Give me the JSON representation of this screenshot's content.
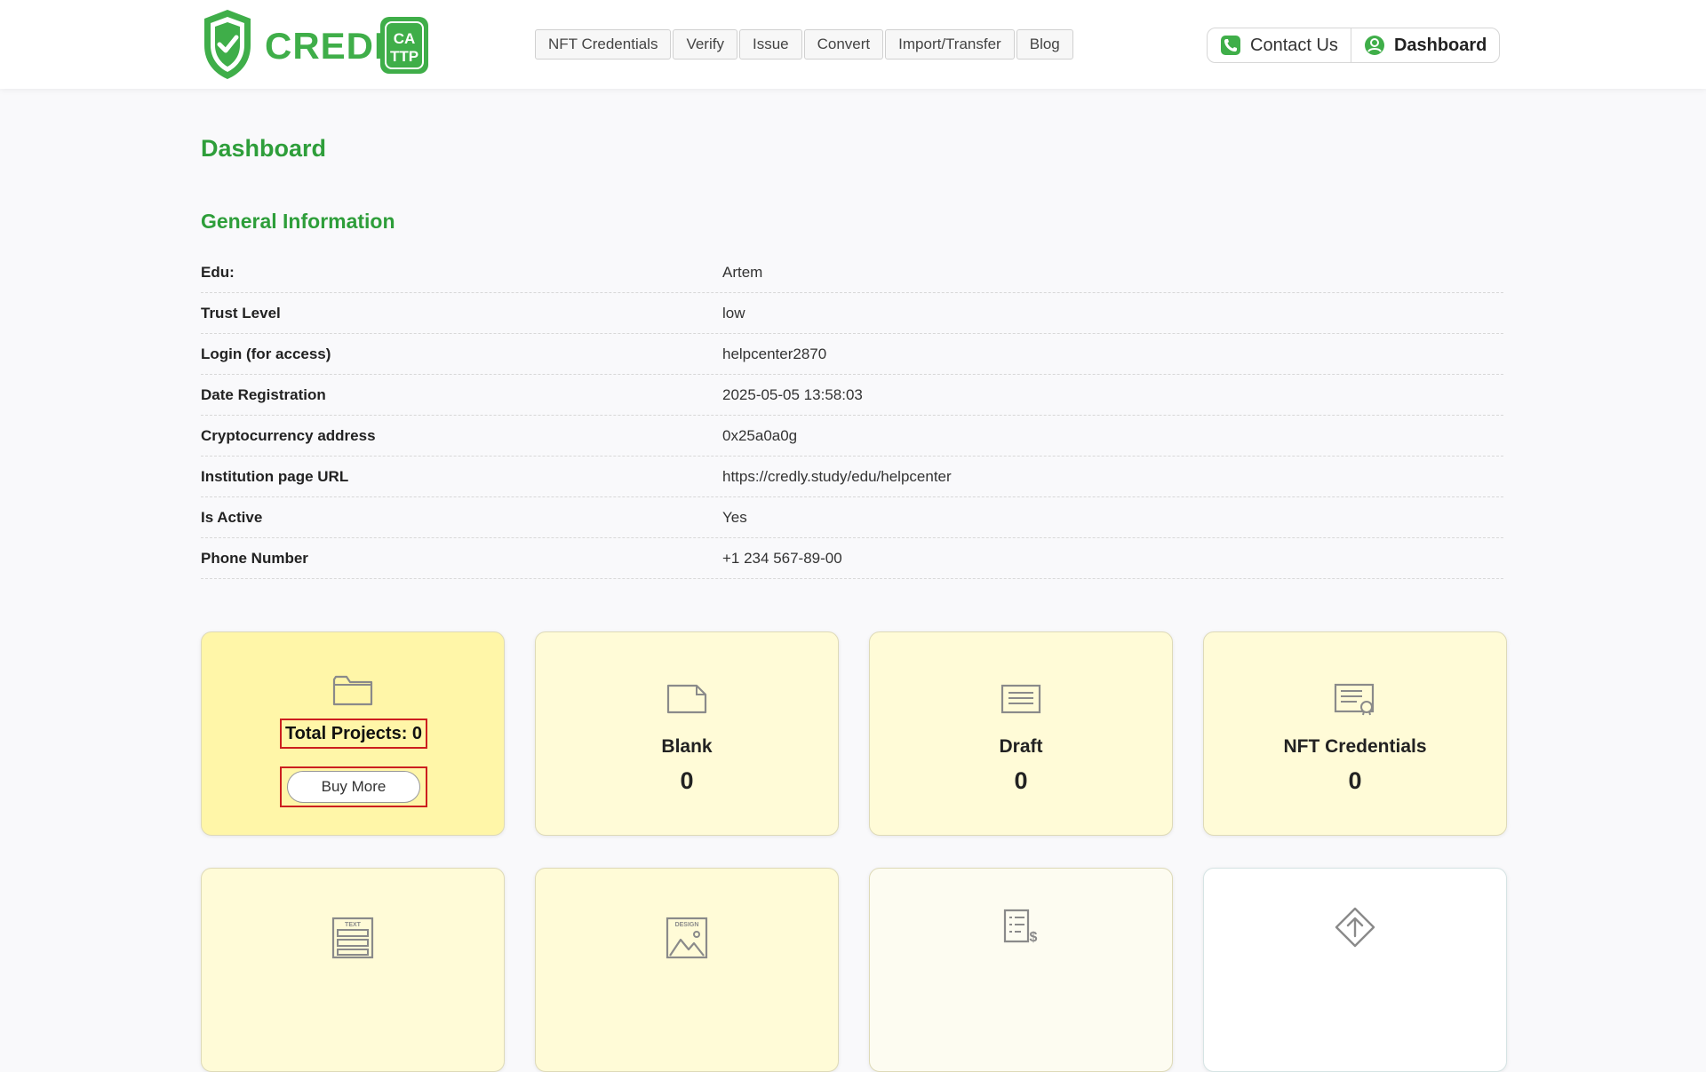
{
  "brand": {
    "name": "CREDLY",
    "badge_line1": "CA",
    "badge_line2": "TTP",
    "color": "#3fae49"
  },
  "nav": {
    "items": [
      {
        "label": "NFT Credentials"
      },
      {
        "label": "Verify"
      },
      {
        "label": "Issue"
      },
      {
        "label": "Convert"
      },
      {
        "label": "Import/Transfer"
      },
      {
        "label": "Blog"
      }
    ]
  },
  "header_actions": {
    "contact": {
      "label": "Contact Us",
      "icon": "phone-icon"
    },
    "dashboard": {
      "label": "Dashboard",
      "icon": "user-circle-icon"
    }
  },
  "page": {
    "title": "Dashboard",
    "section_title": "General Information"
  },
  "info": [
    {
      "label": "Edu:",
      "value": "Artem"
    },
    {
      "label": "Trust Level",
      "value": "low"
    },
    {
      "label": "Login (for access)",
      "value": "helpcenter2870"
    },
    {
      "label": "Date Registration",
      "value": "2025-05-05 13:58:03"
    },
    {
      "label": "Cryptocurrency address",
      "value": "0x25a0a0g"
    },
    {
      "label": "Institution page URL",
      "value": "https://credly.study/edu/helpcenter"
    },
    {
      "label": "Is Active",
      "value": "Yes"
    },
    {
      "label": "Phone Number",
      "value": "+1 234 567-89-00"
    }
  ],
  "cards": {
    "total": {
      "label": "Total Projects: 0",
      "button": "Buy More",
      "icon": "folder-icon"
    },
    "blank": {
      "label": "Blank",
      "count": "0",
      "icon": "blank-document-icon"
    },
    "draft": {
      "label": "Draft",
      "count": "0",
      "icon": "draft-document-icon"
    },
    "nft": {
      "label": "NFT Credentials",
      "count": "0",
      "icon": "certificate-icon"
    },
    "row2": [
      {
        "icon": "text-template-icon",
        "icon_text": "TEXT"
      },
      {
        "icon": "design-template-icon",
        "icon_text": "DESIGN"
      },
      {
        "icon": "invoice-icon"
      },
      {
        "icon": "upload-diamond-icon"
      }
    ]
  },
  "colors": {
    "accent_green": "#2e9e3a",
    "card_yellow": "#fffbd7",
    "card_highlight": "#fff6a8",
    "annotation_red": "#cc1f1f"
  }
}
